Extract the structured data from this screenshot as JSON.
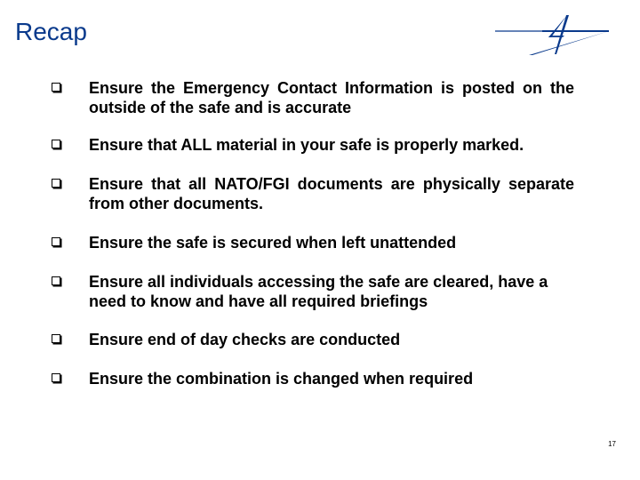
{
  "slide": {
    "title": "Recap",
    "logo_icon": "star-swoosh-logo-icon",
    "page_number": "17",
    "accent_color": "#0a3a8c",
    "bullets": [
      {
        "icon": "checkbox-square-icon",
        "text": "Ensure the Emergency Contact Information is posted on the outside of the safe and is accurate"
      },
      {
        "icon": "checkbox-square-icon",
        "text": "Ensure that ALL material in your safe is properly marked."
      },
      {
        "icon": "checkbox-square-icon",
        "text": "Ensure that all NATO/FGI documents are physically separate from other documents."
      },
      {
        "icon": "checkbox-square-icon",
        "text": "Ensure the safe is secured when left unattended"
      },
      {
        "icon": "checkbox-square-icon",
        "text": "Ensure all individuals accessing the safe are cleared, have a need to know and have all required briefings"
      },
      {
        "icon": "checkbox-square-icon",
        "text": "Ensure end of day checks are conducted"
      },
      {
        "icon": "checkbox-square-icon",
        "text": "Ensure the combination is changed when required"
      }
    ]
  }
}
